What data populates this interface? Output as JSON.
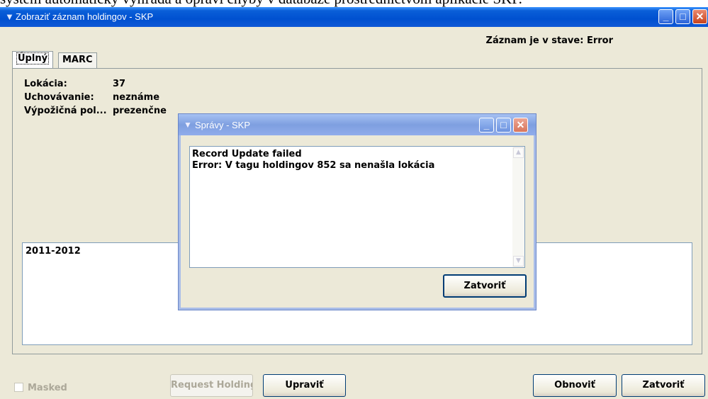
{
  "background_text": "systém automaticky vyhľadá a opraví chyby v databáze prostredníctvom aplikácie SKP.",
  "window": {
    "title": "Zobraziť záznam holdingov - SKP",
    "icon": "app-shield-icon"
  },
  "status": "Záznam je v stave: Error",
  "tabs": [
    {
      "label": "Úplný"
    },
    {
      "label": "MARC"
    }
  ],
  "fields": [
    {
      "label": "Lokácia:",
      "value": "37"
    },
    {
      "label": "Uchovávanie:",
      "value": "neznáme"
    },
    {
      "label": "Výpožičná pol...",
      "value": "prezenčne"
    }
  ],
  "notes_text": "2011-2012",
  "buttons": {
    "masked": "Masked",
    "request_holding": "Request Holding",
    "upravit": "Upraviť",
    "obnovit": "Obnoviť",
    "zatvorit": "Zatvoriť"
  },
  "dialog": {
    "title": "Správy - SKP",
    "lines": [
      "Record Update failed",
      "Error: V tagu holdingov 852 sa nenašla lokácia"
    ],
    "close_button": "Zatvoriť"
  }
}
